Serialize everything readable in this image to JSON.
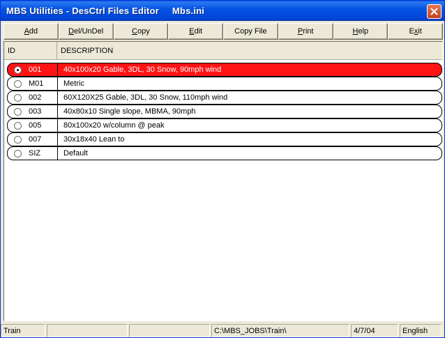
{
  "window": {
    "title": "MBS Utilities - DesCtrl Files Editor     Mbs.ini"
  },
  "toolbar": {
    "buttons": [
      {
        "pre": "",
        "u": "A",
        "post": "dd"
      },
      {
        "pre": "",
        "u": "D",
        "post": "el/UnDel"
      },
      {
        "pre": "",
        "u": "C",
        "post": "opy"
      },
      {
        "pre": "",
        "u": "E",
        "post": "dit"
      },
      {
        "pre": "Copy File",
        "u": "",
        "post": ""
      },
      {
        "pre": "",
        "u": "P",
        "post": "rint"
      },
      {
        "pre": "",
        "u": "H",
        "post": "elp"
      },
      {
        "pre": "E",
        "u": "x",
        "post": "it"
      }
    ]
  },
  "grid": {
    "columns": {
      "id": "ID",
      "description": "DESCRIPTION"
    },
    "rows": [
      {
        "id": "001",
        "description": "40x100x20 Gable, 3DL, 30 Snow, 90mph wind",
        "selected": true
      },
      {
        "id": "M01",
        "description": "Metric",
        "selected": false
      },
      {
        "id": "002",
        "description": "60X120X25 Gable, 3DL, 30 Snow, 110mph wind",
        "selected": false
      },
      {
        "id": "003",
        "description": "40x80x10 Single slope, MBMA, 90mph",
        "selected": false
      },
      {
        "id": "005",
        "description": "80x100x20 w/column @ peak",
        "selected": false
      },
      {
        "id": "007",
        "description": "30x18x40 Lean to",
        "selected": false
      },
      {
        "id": "SIZ",
        "description": "Default",
        "selected": false
      }
    ],
    "selected_color": "#ff1414"
  },
  "status": {
    "panel1": "Train",
    "panel2": "",
    "panel3": "",
    "path": "C:\\MBS_JOBS\\Train\\",
    "panel5": "",
    "date": "4/7/04",
    "language": "English"
  },
  "icons": {
    "close": "close-icon",
    "radio": "radio-icon"
  }
}
